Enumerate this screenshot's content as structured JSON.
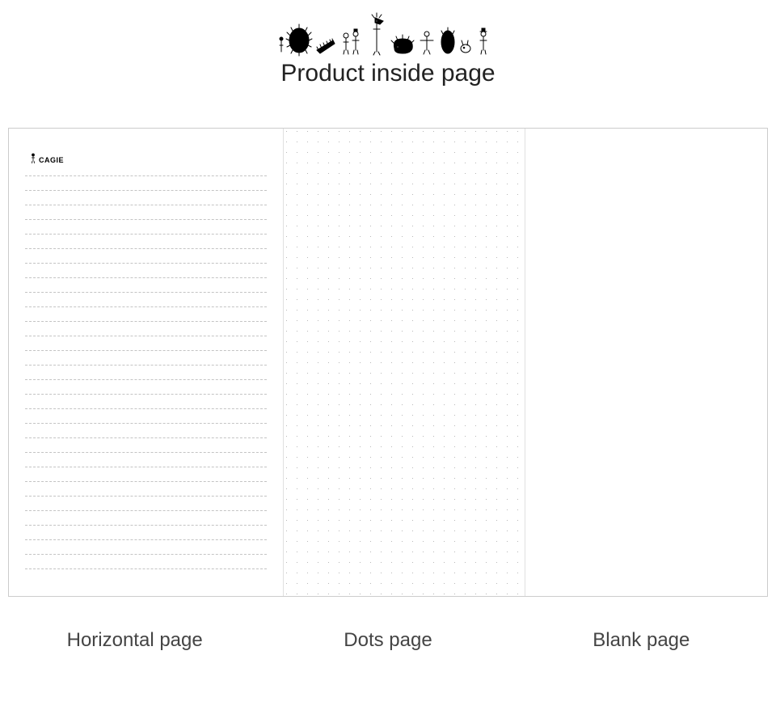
{
  "header": {
    "title": "Product inside page"
  },
  "brand": {
    "name": "CAGIE"
  },
  "pages": [
    {
      "key": "horizontal",
      "label": "Horizontal page"
    },
    {
      "key": "dots",
      "label": "Dots page"
    },
    {
      "key": "blank",
      "label": "Blank  page"
    }
  ]
}
